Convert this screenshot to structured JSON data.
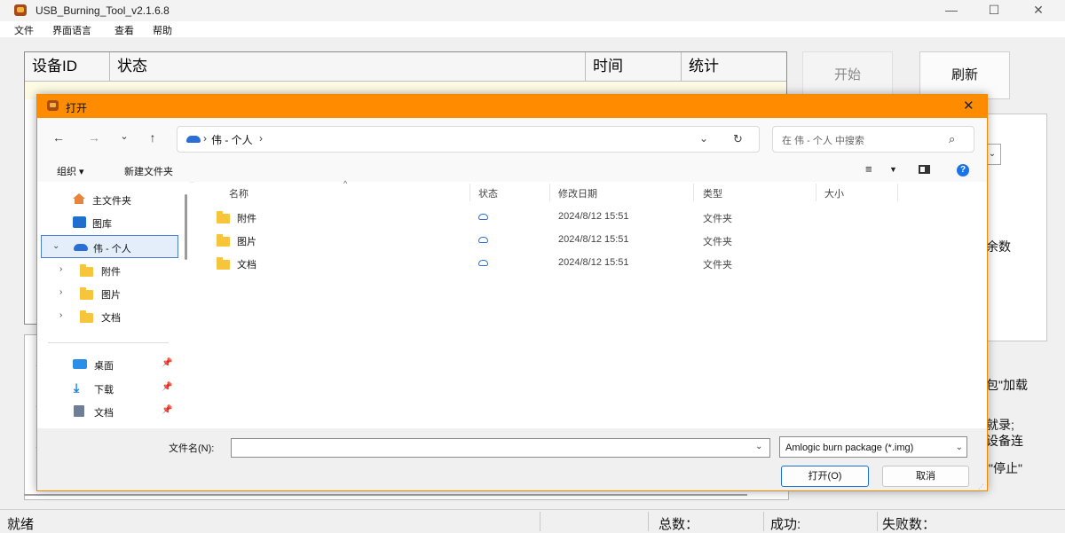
{
  "app": {
    "title": "USB_Burning_Tool_v2.1.6.8",
    "menu": [
      "文件",
      "界面语言",
      "查看",
      "帮助"
    ],
    "device_table_headers": [
      "设备ID",
      "状态",
      "时间",
      "统计"
    ],
    "start_button": "开始",
    "refresh_button": "刷新",
    "right_texts": [
      "余数",
      "包\"加载",
      "就录;",
      "设备连",
      "七\"停止\""
    ],
    "status": {
      "ready": "就绪",
      "total": "总数：",
      "success": "成功:",
      "fail": "失败数："
    }
  },
  "dialog": {
    "title": "打开",
    "breadcrumb": [
      "伟 - 个人"
    ],
    "search_placeholder": "在 伟 - 个人 中搜索",
    "commands": {
      "organize": "组织 ▾",
      "new_folder": "新建文件夹"
    },
    "nav": {
      "home": "主文件夹",
      "gallery": "图库",
      "onedrive": "伟 - 个人",
      "sub": [
        "附件",
        "图片",
        "文档"
      ],
      "quick": [
        "桌面",
        "下载",
        "文档"
      ]
    },
    "columns": [
      "名称",
      "状态",
      "修改日期",
      "类型",
      "大小"
    ],
    "files": [
      {
        "name": "附件",
        "date": "2024/8/12 15:51",
        "type": "文件夹"
      },
      {
        "name": "图片",
        "date": "2024/8/12 15:51",
        "type": "文件夹"
      },
      {
        "name": "文档",
        "date": "2024/8/12 15:51",
        "type": "文件夹"
      }
    ],
    "filename_label": "文件名(N):",
    "filename_value": "",
    "filetype": "Amlogic burn package (*.img)",
    "open_button": "打开(O)",
    "cancel_button": "取消"
  }
}
